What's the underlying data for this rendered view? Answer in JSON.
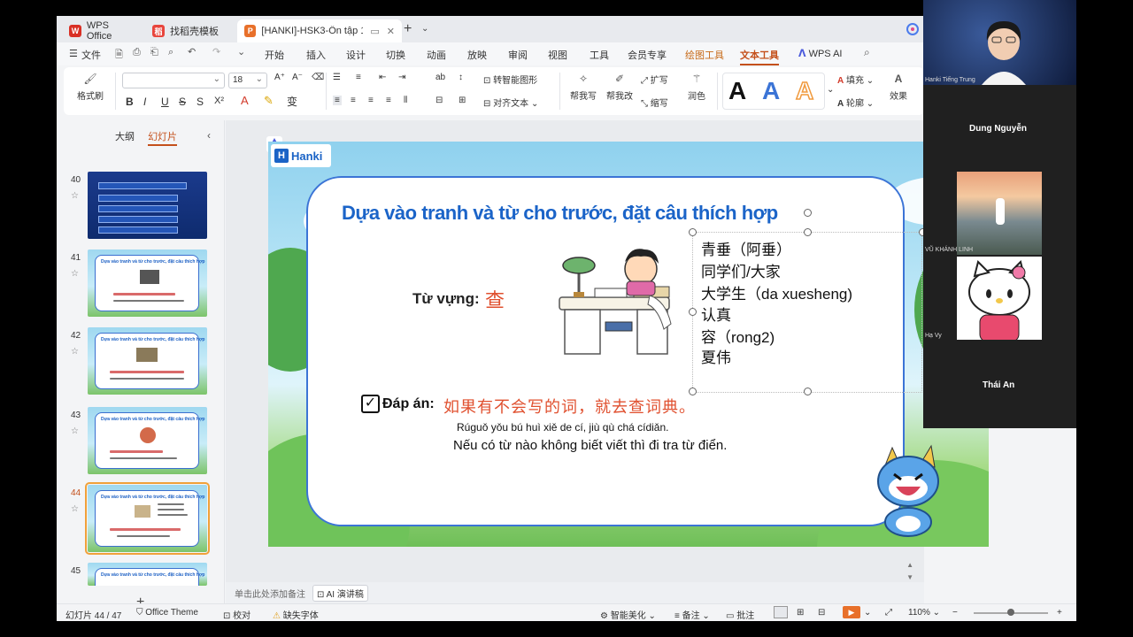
{
  "titlebar": {
    "tabs": [
      {
        "label": "WPS Office",
        "color": "#d93025"
      },
      {
        "label": "找稻壳模板",
        "color": "#e8453c"
      },
      {
        "label": "[HANKI]-HSK3-Ôn tập 1 (T",
        "color": "#e8702a"
      }
    ]
  },
  "menubar": {
    "file": "文件",
    "items": [
      "开始",
      "插入",
      "设计",
      "切换",
      "动画",
      "放映",
      "审阅",
      "视图",
      "工具",
      "会员专享",
      "绘图工具",
      "文本工具",
      "WPS AI"
    ]
  },
  "ribbon": {
    "format_painter": "格式刷",
    "font_size": "18",
    "bold": "B",
    "italic": "I",
    "underline": "U",
    "smart_shape": "转智能图形",
    "align_text": "对齐文本",
    "help_write": "帮我写",
    "help_edit": "帮我改",
    "expand": "扩写",
    "shrink": "缩写",
    "polish": "润色",
    "fill": "填充",
    "outline": "轮廓",
    "effect": "效果",
    "style_letter": "A"
  },
  "leftpanel": {
    "tab_outline": "大纲",
    "tab_slides": "幻灯片",
    "slides": [
      {
        "num": "40"
      },
      {
        "num": "41"
      },
      {
        "num": "42"
      },
      {
        "num": "43"
      },
      {
        "num": "44"
      },
      {
        "num": "45"
      }
    ],
    "thumb_title": "Dựa vào tranh và từ cho trước, đặt câu thích hợp"
  },
  "slide": {
    "logo": "Hanki",
    "title": "Dựa vào tranh và từ cho trước, đặt câu thích hợp",
    "vocab_label": "Từ vựng:",
    "vocab_word": "查",
    "words": [
      "青垂（阿垂）",
      "同学们/大家",
      "大学生（da xuesheng)",
      "认真",
      "容（rong2)",
      "夏伟"
    ],
    "answer_label": "Đáp án:",
    "answer_zh": "如果有不会写的词，就去查词典。",
    "answer_pinyin": "Rúguǒ yǒu bú huì xiě de cí, jiù qù chá cídiǎn.",
    "answer_vi": "Nếu có từ nào không biết viết thì đi tra từ điển."
  },
  "notes": {
    "placeholder": "单击此处添加备注",
    "ai_button": "AI 演讲稿"
  },
  "statusbar": {
    "slide_count": "幻灯片 44 / 47",
    "theme": "Office Theme",
    "proof": "校对",
    "missing_font": "缺失字体",
    "beautify": "智能美化",
    "notes": "备注",
    "comments": "批注",
    "zoom": "110%"
  },
  "call": {
    "host_label": "Hanki Tiếng Trung",
    "participants": [
      "Dung Nguyễn",
      "VŨ KHÁNH LINH",
      "Hạ Vy",
      "Thái An"
    ]
  }
}
